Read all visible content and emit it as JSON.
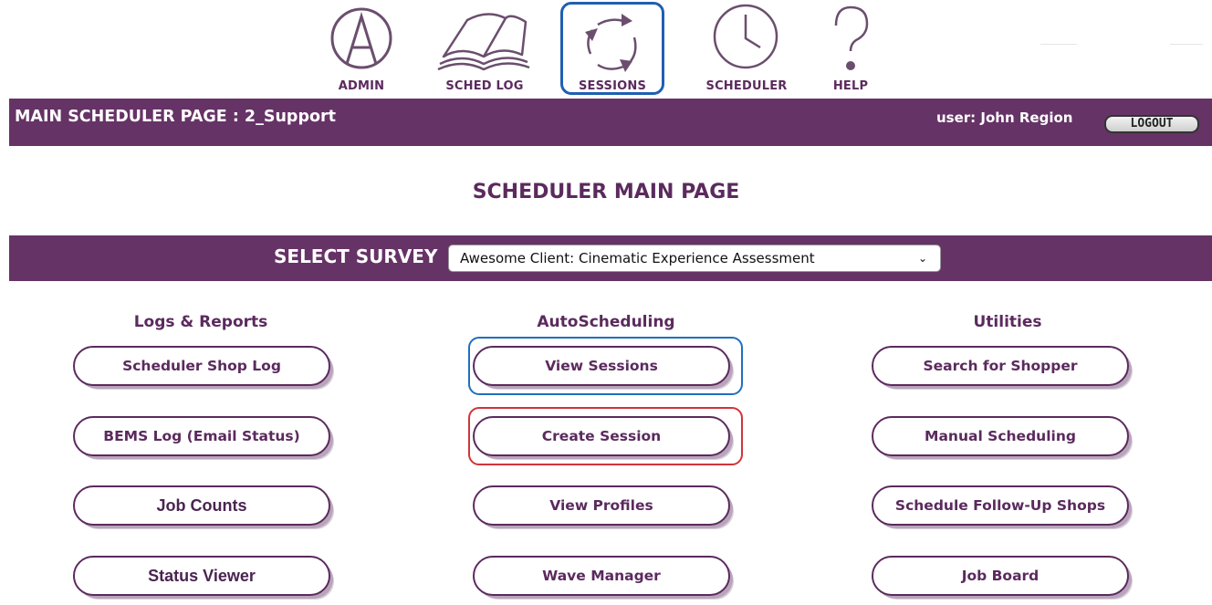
{
  "nav": {
    "items": [
      {
        "label": "ADMIN",
        "icon": "admin-a-circle-icon"
      },
      {
        "label": "SCHED LOG",
        "icon": "open-book-icon"
      },
      {
        "label": "SESSIONS",
        "icon": "cycle-arrows-icon",
        "active": true
      },
      {
        "label": "SCHEDULER",
        "icon": "clock-icon"
      },
      {
        "label": "HELP",
        "icon": "question-mark-icon"
      }
    ]
  },
  "header": {
    "title": "MAIN SCHEDULER PAGE : 2_Support",
    "user": "user: John Region",
    "logout_label": "LOGOUT"
  },
  "main_heading": "SCHEDULER MAIN PAGE",
  "survey": {
    "label": "SELECT SURVEY",
    "selected": "Awesome Client: Cinematic Experience Assessment",
    "chevron": "⌄"
  },
  "columns": [
    {
      "heading": "Logs & Reports",
      "buttons": [
        "Scheduler Shop Log",
        "BEMS Log (Email Status)",
        "Job Counts",
        "Status Viewer"
      ]
    },
    {
      "heading": "AutoScheduling",
      "buttons": [
        "View Sessions",
        "Create Session",
        "View Profiles",
        "Wave Manager"
      ]
    },
    {
      "heading": "Utilities",
      "buttons": [
        "Search for Shopper",
        "Manual Scheduling",
        "Schedule Follow-Up Shops",
        "Job Board"
      ]
    }
  ],
  "colors": {
    "brand_purple": "#663366",
    "text_purple": "#5b2a5e",
    "highlight_blue": "#1f6fbf",
    "highlight_red": "#d0343a"
  }
}
